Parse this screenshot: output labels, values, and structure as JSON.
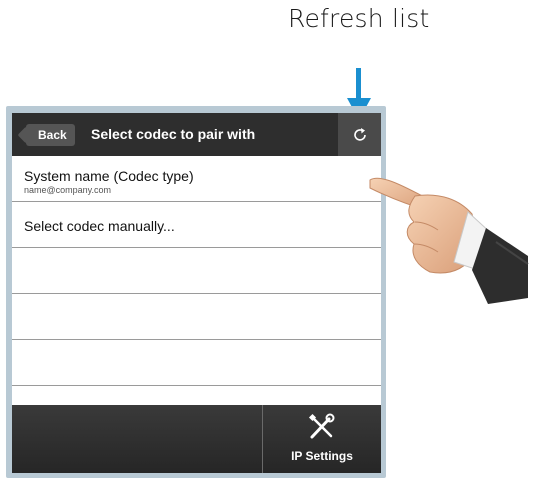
{
  "annotation": {
    "label": "Refresh list",
    "arrow_color": "#1a8fd0"
  },
  "header": {
    "back_label": "Back",
    "title": "Select codec to pair with",
    "refresh_icon": "refresh-icon"
  },
  "list": {
    "items": [
      {
        "title": "System name (Codec type)",
        "subtitle": "name@company.com"
      },
      {
        "title": "Select codec manually..."
      },
      {
        "title": ""
      },
      {
        "title": ""
      },
      {
        "title": ""
      }
    ]
  },
  "footer": {
    "ip_settings_label": "IP Settings",
    "ip_settings_icon": "wrench-screwdriver-icon"
  },
  "colors": {
    "device_frame": "#b8c9d4",
    "bar_dark": "#2e2e2e"
  }
}
